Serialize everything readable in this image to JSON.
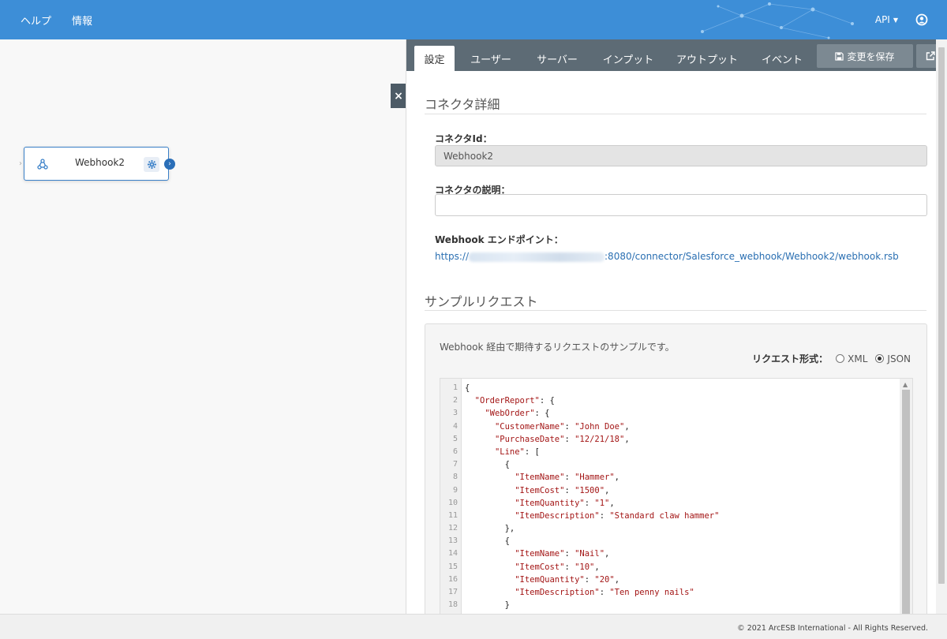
{
  "topbar": {
    "nav": [
      {
        "name": "nav-truncated",
        "label": "ヘ"
      },
      {
        "name": "nav-help",
        "label": "ヘルプ"
      },
      {
        "name": "nav-info",
        "label": "情報"
      }
    ],
    "api_label": "API",
    "icons": {
      "api_caret": "caret-down-icon",
      "user": "user-circle-icon"
    },
    "color": "#3d8ed7"
  },
  "canvas": {
    "node": {
      "label": "Webhook2",
      "icons": {
        "type": "webhook-icon",
        "settings": "gear-icon",
        "output": "chevron-right-icon",
        "input": "chevron-right-icon"
      }
    },
    "close_label": "×"
  },
  "panel": {
    "tabs": [
      {
        "id": "settings",
        "label": "設定",
        "active": true
      },
      {
        "id": "users",
        "label": "ユーザー"
      },
      {
        "id": "server",
        "label": "サーバー"
      },
      {
        "id": "input",
        "label": "インプット"
      },
      {
        "id": "output",
        "label": "アウトプット"
      },
      {
        "id": "events",
        "label": "イベント"
      }
    ],
    "save_label": "変更を保存",
    "icons": {
      "save": "floppy-disk-icon",
      "popout": "external-link-icon"
    },
    "details": {
      "title": "コネクタ詳細",
      "id_label": "コネクタId：",
      "id_value": "Webhook2",
      "desc_label": "コネクタの説明：",
      "desc_value": "",
      "endpoint_label": "Webhook エンドポイント：",
      "endpoint_prefix": "https://",
      "endpoint_suffix": ":8080/connector/Salesforce_webhook/Webhook2/webhook.rsb"
    },
    "sample": {
      "title": "サンプルリクエスト",
      "description": "Webhook 経由で期待するリクエストのサンプルです。",
      "format_label": "リクエスト形式：",
      "formats": [
        {
          "label": "XML",
          "checked": false
        },
        {
          "label": "JSON",
          "checked": true
        }
      ],
      "code_lines": [
        "{",
        "  \"OrderReport\": {",
        "    \"WebOrder\": {",
        "      \"CustomerName\": \"John Doe\",",
        "      \"PurchaseDate\": \"12/21/18\",",
        "      \"Line\": [",
        "        {",
        "          \"ItemName\": \"Hammer\",",
        "          \"ItemCost\": \"1500\",",
        "          \"ItemQuantity\": \"1\",",
        "          \"ItemDescription\": \"Standard claw hammer\"",
        "        },",
        "        {",
        "          \"ItemName\": \"Nail\",",
        "          \"ItemCost\": \"10\",",
        "          \"ItemQuantity\": \"20\",",
        "          \"ItemDescription\": \"Ten penny nails\"",
        "        }"
      ]
    }
  },
  "footer": {
    "copyright": "© 2021 ArcESB International - All Rights Reserved."
  }
}
